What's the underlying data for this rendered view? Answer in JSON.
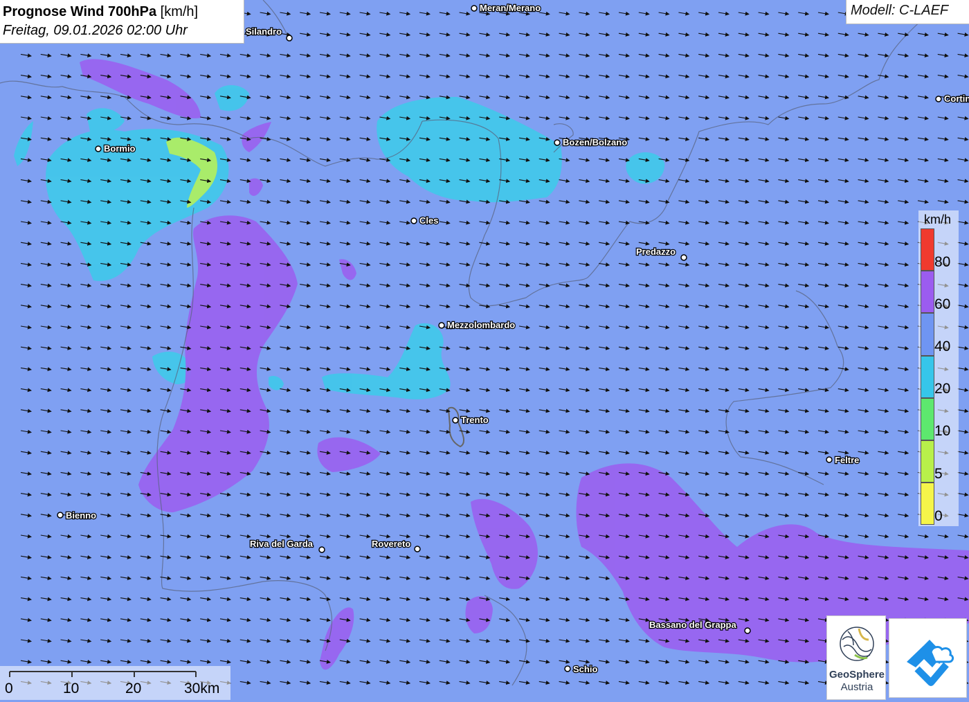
{
  "header": {
    "title_bold": "Prognose Wind 700hPa",
    "title_unit": "[km/h]",
    "subtitle": "Freitag, 09.01.2026 02:00 Uhr"
  },
  "model": {
    "label": "Modell: C-LAEF"
  },
  "legend": {
    "unit": "km/h",
    "bins": [
      {
        "label": "80",
        "color": "#f03a2e"
      },
      {
        "label": "60",
        "color": "#9b5cf0"
      },
      {
        "label": "40",
        "color": "#6f95f2"
      },
      {
        "label": "20",
        "color": "#36c6ea"
      },
      {
        "label": "10",
        "color": "#5de86e"
      },
      {
        "label": "5",
        "color": "#b8f04a"
      },
      {
        "label": "0",
        "color": "#f5f54a"
      }
    ]
  },
  "scale_bar": {
    "labels": [
      "0",
      "10",
      "20",
      "30km"
    ]
  },
  "places": [
    {
      "name": "Meran/Merano"
    },
    {
      "name": "Silandro"
    },
    {
      "name": "Bormio"
    },
    {
      "name": "Bozen/Bolzano"
    },
    {
      "name": "Cortina"
    },
    {
      "name": "Cles"
    },
    {
      "name": "Predazzo"
    },
    {
      "name": "Mezzolombardo"
    },
    {
      "name": "Trento"
    },
    {
      "name": "Feltre"
    },
    {
      "name": "Bienno"
    },
    {
      "name": "Riva del Garda"
    },
    {
      "name": "Rovereto"
    },
    {
      "name": "Bassano del Grappa"
    },
    {
      "name": "Schio"
    }
  ],
  "logos": {
    "geosphere_name": "GeoSphere",
    "geosphere_sub": "Austria"
  },
  "colors": {
    "base_wind": "#7fa0f2",
    "cyan_zone": "#3ccbea",
    "purple_zone": "#9a61ef",
    "green_zone": "#a9ec6a"
  }
}
